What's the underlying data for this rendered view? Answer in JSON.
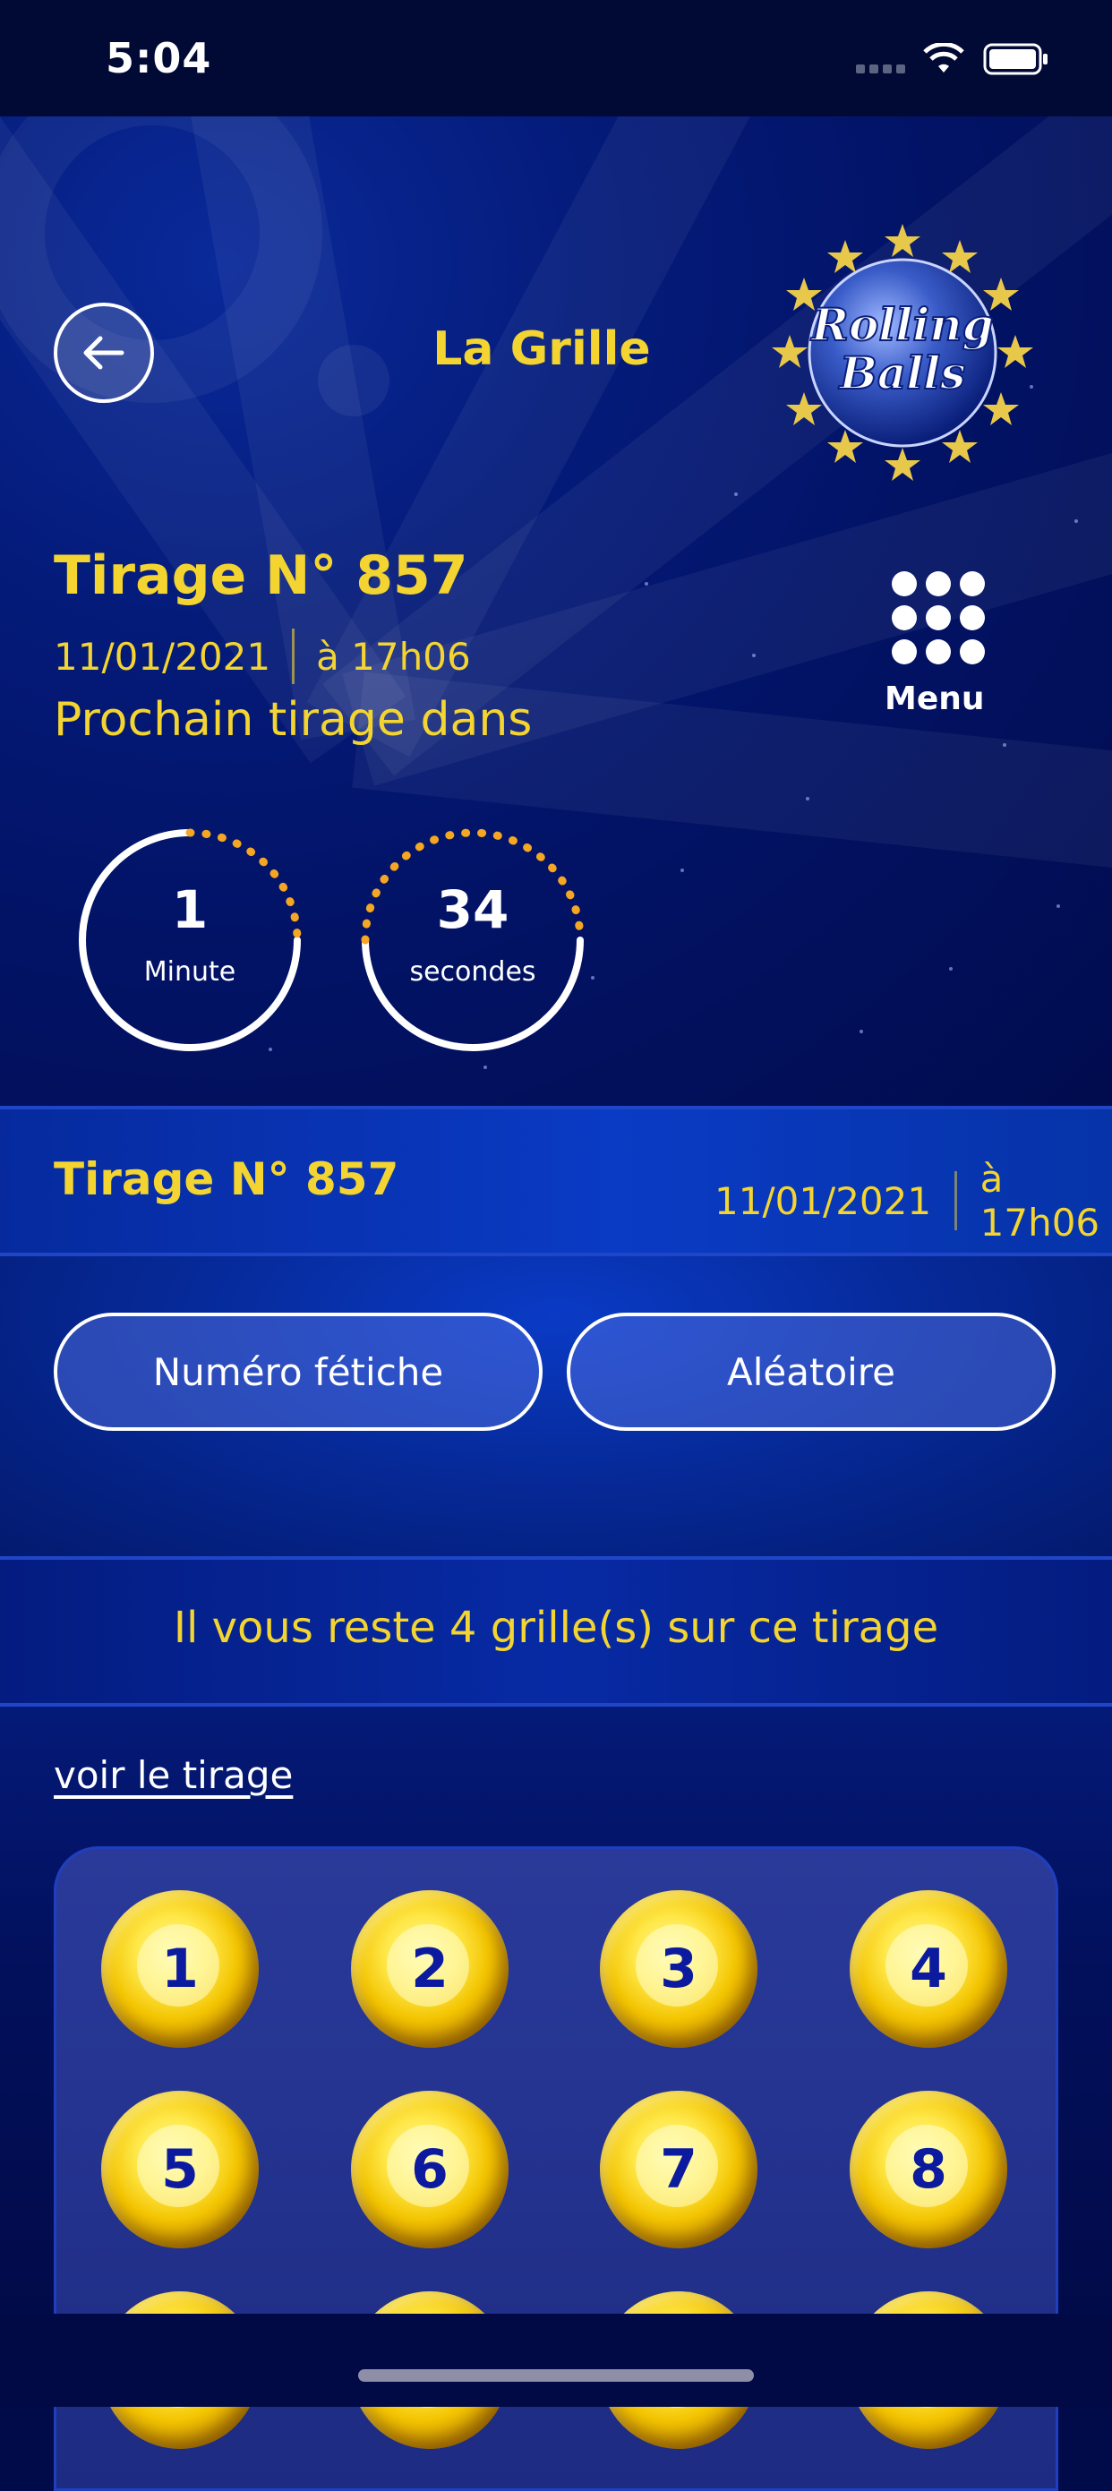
{
  "status_bar": {
    "time": "5:04"
  },
  "header": {
    "title": "La Grille",
    "logo_text_line1": "Rolling",
    "logo_text_line2": "Balls"
  },
  "draw": {
    "title": "Tirage N° 857",
    "date": "11/01/2021",
    "time": "à 17h06",
    "countdown_label": "Prochain tirage dans",
    "minutes_value": "1",
    "minutes_label": "Minute",
    "seconds_value": "34",
    "seconds_label": "secondes"
  },
  "menu": {
    "label": "Menu"
  },
  "draw_bar": {
    "title": "Tirage N° 857",
    "date": "11/01/2021",
    "time": "à 17h06"
  },
  "actions": {
    "fetiche_label": "Numéro fétiche",
    "aleatoire_label": "Aléatoire"
  },
  "remaining": {
    "text": "Il vous reste 4 grille(s) sur ce tirage"
  },
  "link": {
    "voir_label": "voir le tirage"
  },
  "grid": {
    "numbers": [
      "1",
      "2",
      "3",
      "4",
      "5",
      "6",
      "7",
      "8"
    ]
  },
  "colors": {
    "accent_yellow": "#f3d431",
    "ring_orange": "#f5a623",
    "background_blue": "#020b4a"
  }
}
